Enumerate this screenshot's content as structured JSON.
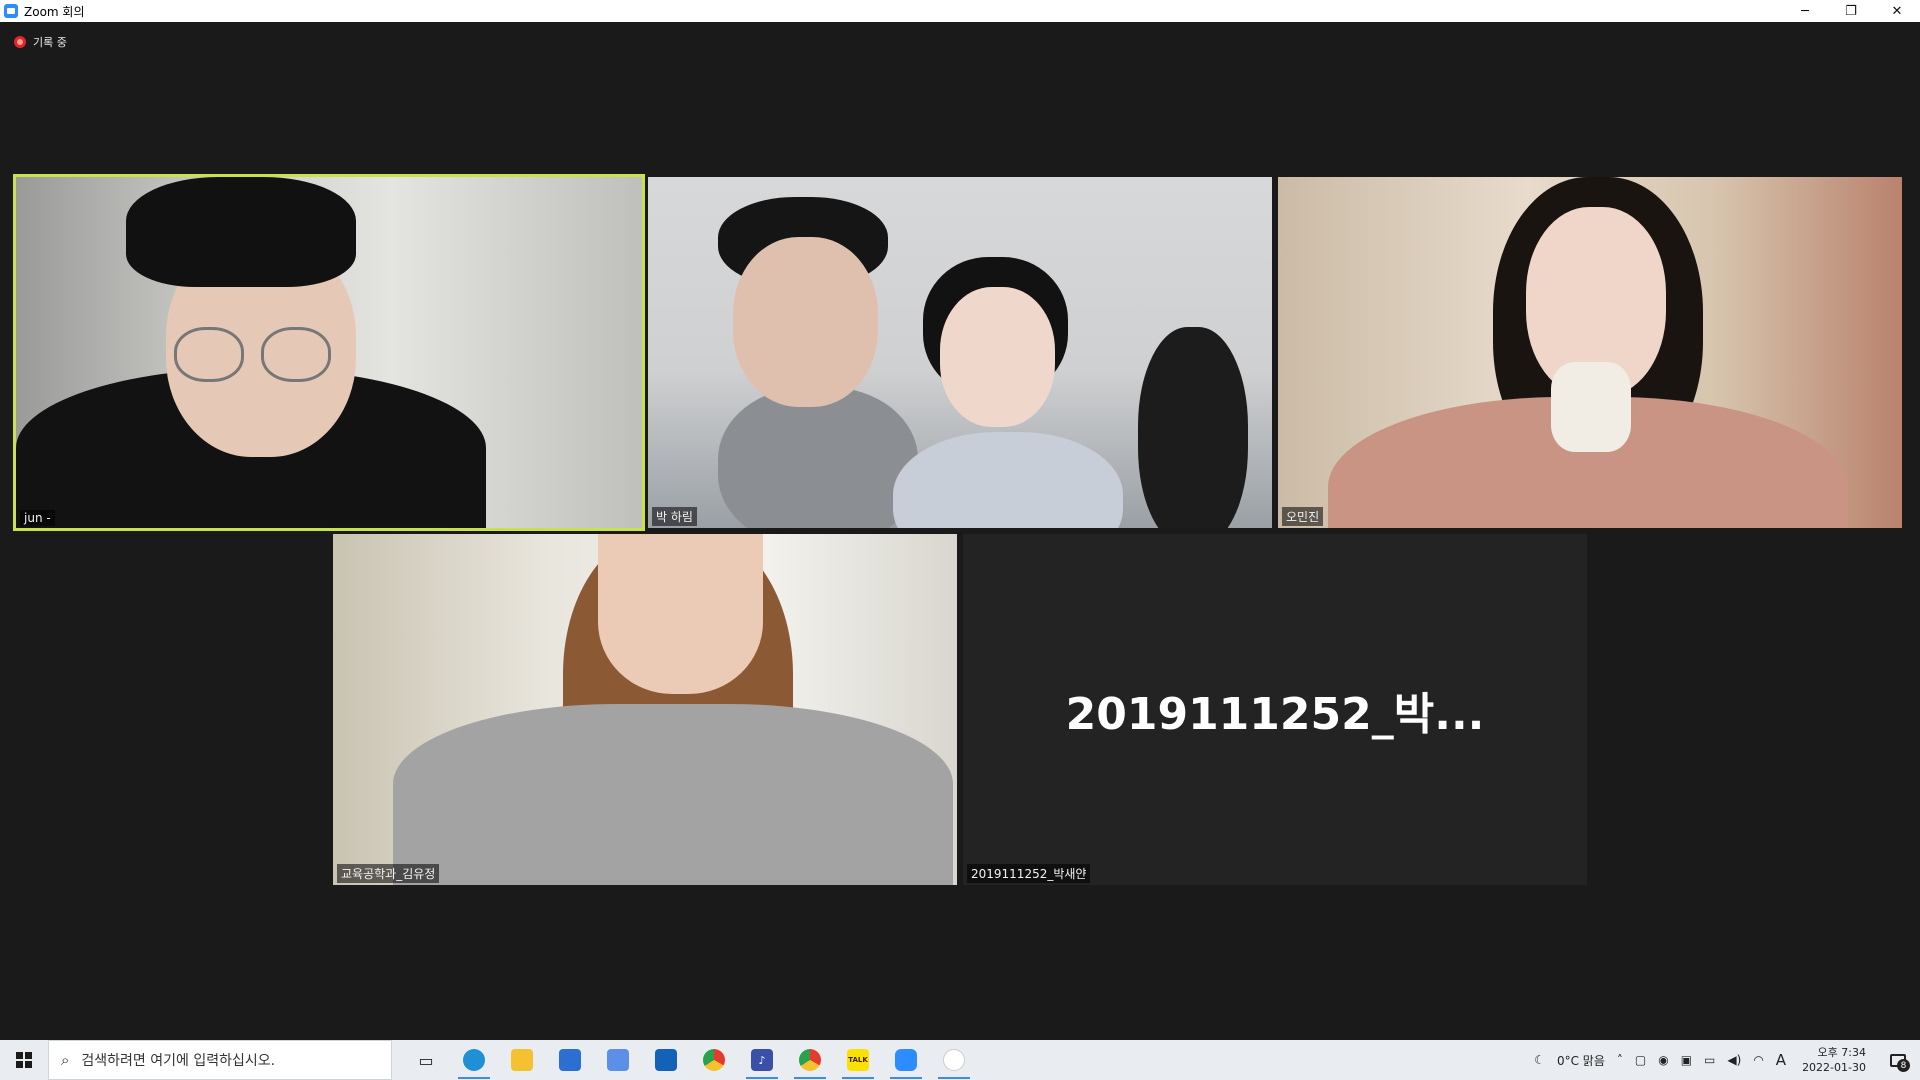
{
  "window": {
    "title": "Zoom 회의",
    "minimize": "─",
    "restore": "❐",
    "close": "✕"
  },
  "recording": {
    "label": "기록 중"
  },
  "participants": [
    {
      "name": "jun -",
      "active_speaker": true
    },
    {
      "name": "박 하림"
    },
    {
      "name": "오민진"
    },
    {
      "name": "교육공학과_김유정"
    },
    {
      "name": "2019111252_박새얀",
      "placeholder": "2019111252_박..."
    }
  ],
  "taskbar": {
    "search_placeholder": "검색하려면 여기에 입력하십시오.",
    "apps": [
      {
        "icon": "task-view-icon",
        "label": ""
      },
      {
        "icon": "edge-icon",
        "label": ""
      },
      {
        "icon": "file-explorer-icon",
        "label": ""
      },
      {
        "icon": "store-icon",
        "label": ""
      },
      {
        "icon": "settings-app-icon",
        "label": ""
      },
      {
        "icon": "mail-icon",
        "label": ""
      },
      {
        "icon": "chrome-icon",
        "label": ""
      },
      {
        "icon": "music-app-icon",
        "label": ""
      },
      {
        "icon": "chrome-profile-icon",
        "label": ""
      },
      {
        "icon": "kakaotalk-icon",
        "label": "TALK"
      },
      {
        "icon": "zoom-icon",
        "label": ""
      },
      {
        "icon": "unknown-app-icon",
        "label": ""
      }
    ],
    "weather": "0°C  맑음",
    "language": "A",
    "time": "오후 7:34",
    "date": "2022-01-30",
    "notification_count": "8"
  },
  "colors": {
    "active_speaker_border": "#c7e24a",
    "meeting_background": "#1a1a1a",
    "recording_dot": "#e02828"
  }
}
